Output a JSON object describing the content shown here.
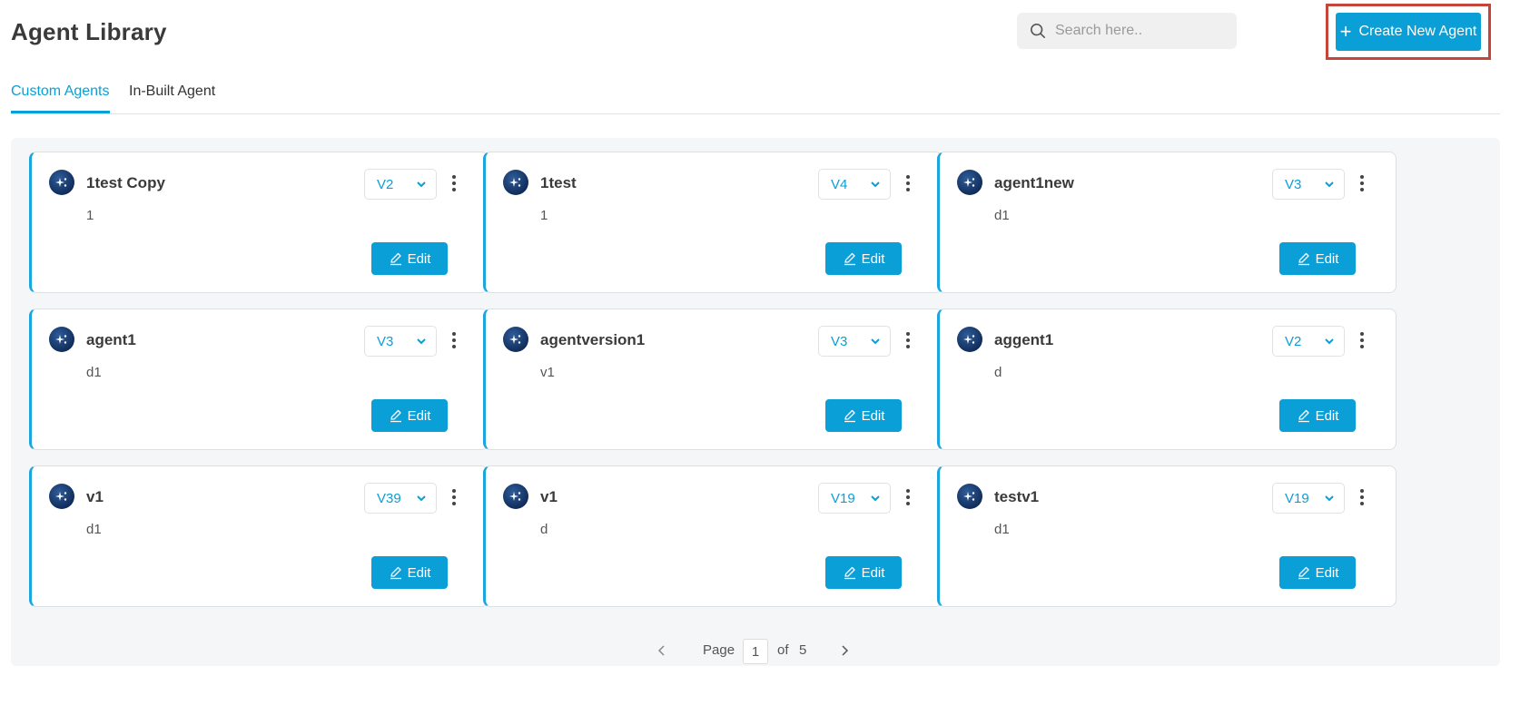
{
  "header": {
    "title": "Agent Library",
    "search_placeholder": "Search here..",
    "create_label": "Create New Agent"
  },
  "tabs": [
    {
      "label": "Custom Agents",
      "active": true
    },
    {
      "label": "In-Built Agent",
      "active": false
    }
  ],
  "cards": [
    {
      "name": "1test Copy",
      "description": "1",
      "version": "V2",
      "edit_label": "Edit"
    },
    {
      "name": "1test",
      "description": "1",
      "version": "V4",
      "edit_label": "Edit"
    },
    {
      "name": "agent1new",
      "description": "d1",
      "version": "V3",
      "edit_label": "Edit"
    },
    {
      "name": "agent1",
      "description": "d1",
      "version": "V3",
      "edit_label": "Edit"
    },
    {
      "name": "agentversion1",
      "description": "v1",
      "version": "V3",
      "edit_label": "Edit"
    },
    {
      "name": "aggent1",
      "description": "d",
      "version": "V2",
      "edit_label": "Edit"
    },
    {
      "name": "v1",
      "description": "d1",
      "version": "V39",
      "edit_label": "Edit"
    },
    {
      "name": "v1",
      "description": "d",
      "version": "V19",
      "edit_label": "Edit"
    },
    {
      "name": "testv1",
      "description": "d1",
      "version": "V19",
      "edit_label": "Edit"
    }
  ],
  "pagination": {
    "page_label": "Page",
    "current_page": "1",
    "of_label": "of",
    "total_pages": "5"
  },
  "colors": {
    "accent": "#0a9fd6",
    "highlight_border": "#c6453a",
    "avatar": "#0f2a57"
  },
  "icons": {
    "search": "search-icon",
    "create": "plus-icon",
    "avatar": "sparkle-icon",
    "version": "chevron-down-icon",
    "menu": "kebab-menu-icon",
    "edit": "pencil-icon",
    "prev": "chevron-left-icon",
    "next": "chevron-right-icon"
  }
}
